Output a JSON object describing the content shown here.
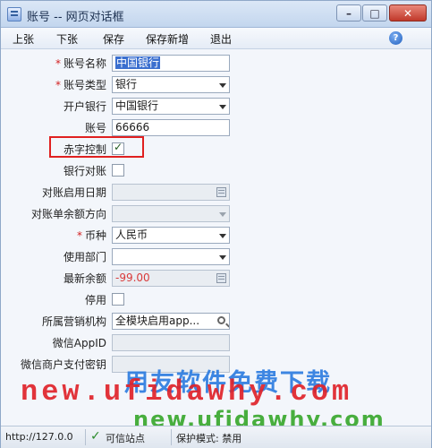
{
  "window": {
    "title": "账号 -- 网页对话框",
    "min_symbol": "–",
    "max_symbol": "□",
    "close_symbol": "✕"
  },
  "toolbar": {
    "prev_label": "上张",
    "next_label": "下张",
    "save_label": "保存",
    "save_new_label": "保存新增",
    "exit_label": "退出",
    "help_symbol": "?"
  },
  "form": {
    "account_name": {
      "label": "账号名称",
      "required": "*",
      "value": "中国银行"
    },
    "account_type": {
      "label": "账号类型",
      "required": "*",
      "value": "银行"
    },
    "bank": {
      "label": "开户银行",
      "value": "中国银行"
    },
    "account_no": {
      "label": "账号",
      "value": "66666"
    },
    "red_control": {
      "label": "赤字控制",
      "checked": true
    },
    "bank_reconcile": {
      "label": "银行对账",
      "checked": false
    },
    "reconcile_start_date": {
      "label": "对账启用日期",
      "value": ""
    },
    "statement_direction": {
      "label": "对账单余额方向",
      "value": ""
    },
    "currency": {
      "label": "币种",
      "required": "*",
      "value": "人民币"
    },
    "department": {
      "label": "使用部门",
      "value": ""
    },
    "latest_balance": {
      "label": "最新余额",
      "value": "-99.00"
    },
    "disabled": {
      "label": "停用",
      "checked": false
    },
    "sales_org": {
      "label": "所属营销机构",
      "value": "全模块启用app..."
    },
    "wechat_appid": {
      "label": "微信AppID",
      "value": ""
    },
    "wechat_key": {
      "label": "微信商户支付密钥",
      "value": ""
    }
  },
  "watermark": {
    "line1": "用友软件免费下载",
    "line2": "new.ufidawhy.com",
    "line3": "new.ufidawhy.com"
  },
  "status": {
    "url": "http://127.0.0",
    "check_symbol": "✓",
    "zone": "可信站点",
    "mode": "保护模式: 禁用"
  },
  "colors": {
    "required": "#d21f1f",
    "highlight_box": "#e02020",
    "balance_text": "#d93a3a",
    "selection": "#3b6fcf"
  }
}
